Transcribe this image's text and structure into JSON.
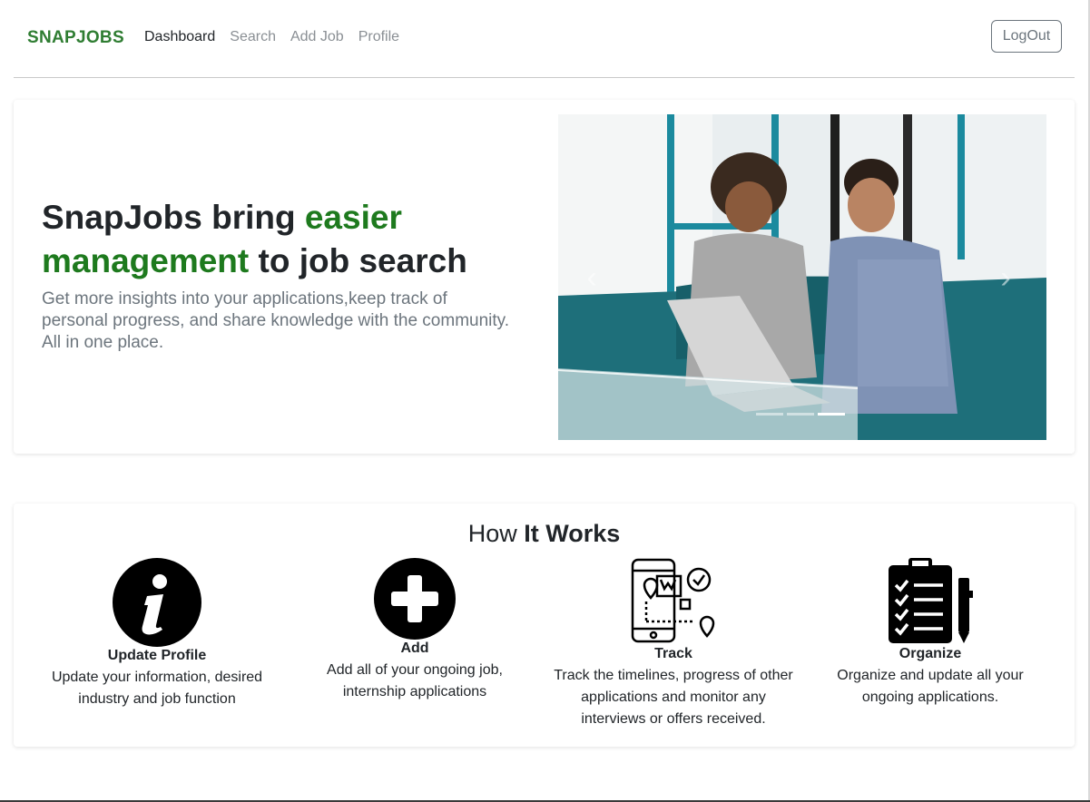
{
  "nav": {
    "brand": "SNAPJOBS",
    "links": [
      {
        "label": "Dashboard",
        "active": true
      },
      {
        "label": "Search",
        "active": false
      },
      {
        "label": "Add Job",
        "active": false
      },
      {
        "label": "Profile",
        "active": false
      }
    ],
    "logout_label": "LogOut"
  },
  "hero": {
    "title_part1": "SnapJobs bring ",
    "title_accent": "easier management",
    "title_part2": " to job search",
    "subtitle": "Get more insights into your applications,keep track of personal progress, and share knowledge with the community. All in one place.",
    "carousel": {
      "slide_count": 3,
      "active_slide": 3
    }
  },
  "how_it_works": {
    "title_regular": "How ",
    "title_bold": "It Works",
    "features": [
      {
        "icon": "info-icon",
        "title": "Update Profile",
        "desc": "Update your information, desired industry and job function"
      },
      {
        "icon": "plus-circle-icon",
        "title": "Add",
        "desc": "Add all of your ongoing job, internship applications"
      },
      {
        "icon": "phone-tracking-icon",
        "title": "Track",
        "desc": "Track the timelines, progress of other applications and monitor any interviews or offers received."
      },
      {
        "icon": "clipboard-checklist-icon",
        "title": "Organize",
        "desc": "Organize and update all your ongoing applications."
      }
    ]
  },
  "colors": {
    "brand_green": "#2f7d32",
    "accent_green": "#1e7a1e",
    "muted_text": "#6c757d"
  }
}
